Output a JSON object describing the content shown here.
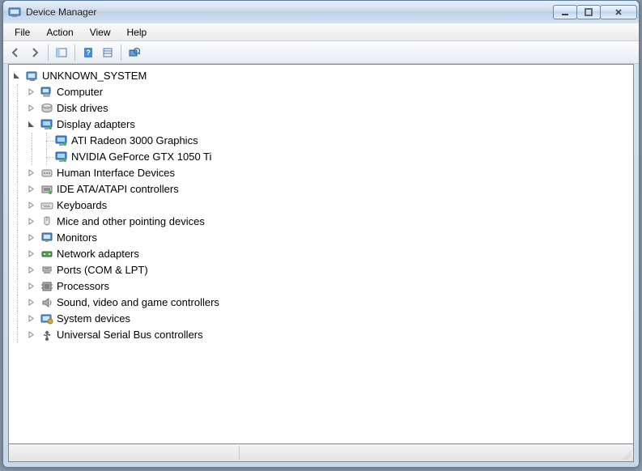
{
  "window": {
    "title": "Device Manager"
  },
  "menu": {
    "file": "File",
    "action": "Action",
    "view": "View",
    "help": "Help"
  },
  "tree": {
    "root": "UNKNOWN_SYSTEM",
    "categories": [
      {
        "label": "Computer",
        "expanded": false,
        "icon": "computer"
      },
      {
        "label": "Disk drives",
        "expanded": false,
        "icon": "disk"
      },
      {
        "label": "Display adapters",
        "expanded": true,
        "icon": "display",
        "children": [
          {
            "label": "ATI Radeon 3000 Graphics"
          },
          {
            "label": "NVIDIA GeForce GTX 1050 Ti"
          }
        ]
      },
      {
        "label": "Human Interface Devices",
        "expanded": false,
        "icon": "hid"
      },
      {
        "label": "IDE ATA/ATAPI controllers",
        "expanded": false,
        "icon": "ide"
      },
      {
        "label": "Keyboards",
        "expanded": false,
        "icon": "keyboard"
      },
      {
        "label": "Mice and other pointing devices",
        "expanded": false,
        "icon": "mouse"
      },
      {
        "label": "Monitors",
        "expanded": false,
        "icon": "monitor"
      },
      {
        "label": "Network adapters",
        "expanded": false,
        "icon": "network"
      },
      {
        "label": "Ports (COM & LPT)",
        "expanded": false,
        "icon": "port"
      },
      {
        "label": "Processors",
        "expanded": false,
        "icon": "cpu"
      },
      {
        "label": "Sound, video and game controllers",
        "expanded": false,
        "icon": "sound"
      },
      {
        "label": "System devices",
        "expanded": false,
        "icon": "system"
      },
      {
        "label": "Universal Serial Bus controllers",
        "expanded": false,
        "icon": "usb"
      }
    ]
  }
}
